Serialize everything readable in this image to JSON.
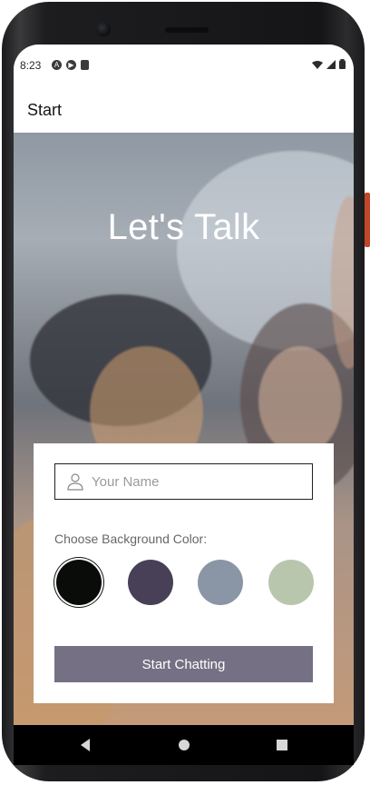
{
  "status_bar": {
    "time": "8:23",
    "left_icons": [
      "a-icon",
      "play-icon",
      "sd-card-icon"
    ],
    "right_icons": [
      "wifi-icon",
      "signal-icon",
      "battery-icon"
    ]
  },
  "app_bar": {
    "title": "Start"
  },
  "hero": {
    "title": "Let's Talk"
  },
  "form": {
    "name_placeholder": "Your Name",
    "name_value": "",
    "color_label": "Choose Background Color:",
    "colors": [
      "#090C08",
      "#474056",
      "#8A95A5",
      "#B9C6AE"
    ],
    "selected_color_index": 0,
    "button_label": "Start Chatting",
    "button_color": "#757083"
  },
  "nav_bar": {
    "buttons": [
      "back-icon",
      "home-icon",
      "recents-icon"
    ]
  }
}
